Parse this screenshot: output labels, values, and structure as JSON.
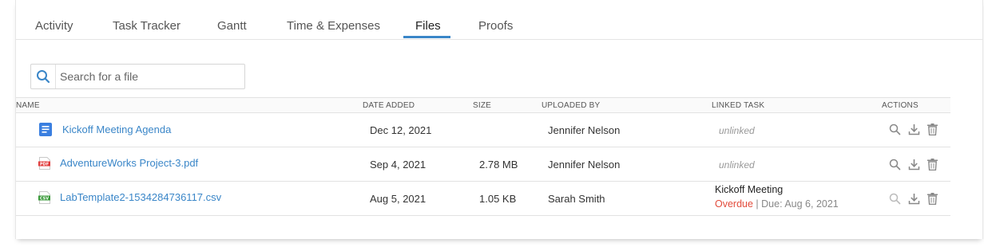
{
  "tabs": [
    {
      "label": "Activity",
      "active": false
    },
    {
      "label": "Task Tracker",
      "active": false
    },
    {
      "label": "Gantt",
      "active": false
    },
    {
      "label": "Time & Expenses",
      "active": false
    },
    {
      "label": "Files",
      "active": true
    },
    {
      "label": "Proofs",
      "active": false
    }
  ],
  "search": {
    "placeholder": "Search for a file",
    "value": ""
  },
  "table": {
    "columns": [
      "NAME",
      "DATE ADDED",
      "SIZE",
      "UPLOADED BY",
      "LINKED TASK",
      "ACTIONS"
    ],
    "rows": [
      {
        "icon": "doc-icon",
        "name": "Kickoff Meeting Agenda",
        "date_added": "Dec 12, 2021",
        "size": "",
        "uploaded_by": "Jennifer Nelson",
        "linked_task": "unlinked"
      },
      {
        "icon": "pdf-icon",
        "name": "AdventureWorks Project-3.pdf",
        "date_added": "Sep 4, 2021",
        "size": "2.78 MB",
        "uploaded_by": "Jennifer Nelson",
        "linked_task": "unlinked"
      },
      {
        "icon": "csv-icon",
        "name": "LabTemplate2-1534284736117.csv",
        "date_added": "Aug 5, 2021",
        "size": "1.05 KB",
        "uploaded_by": "Sarah Smith",
        "linked_task_title": "Kickoff Meeting",
        "linked_task_status": "Overdue",
        "linked_task_separator": " | ",
        "linked_task_due": "Due: Aug 6, 2021"
      }
    ]
  },
  "colors": {
    "accent": "#3a86c8",
    "overdue": "#e24b3b"
  }
}
